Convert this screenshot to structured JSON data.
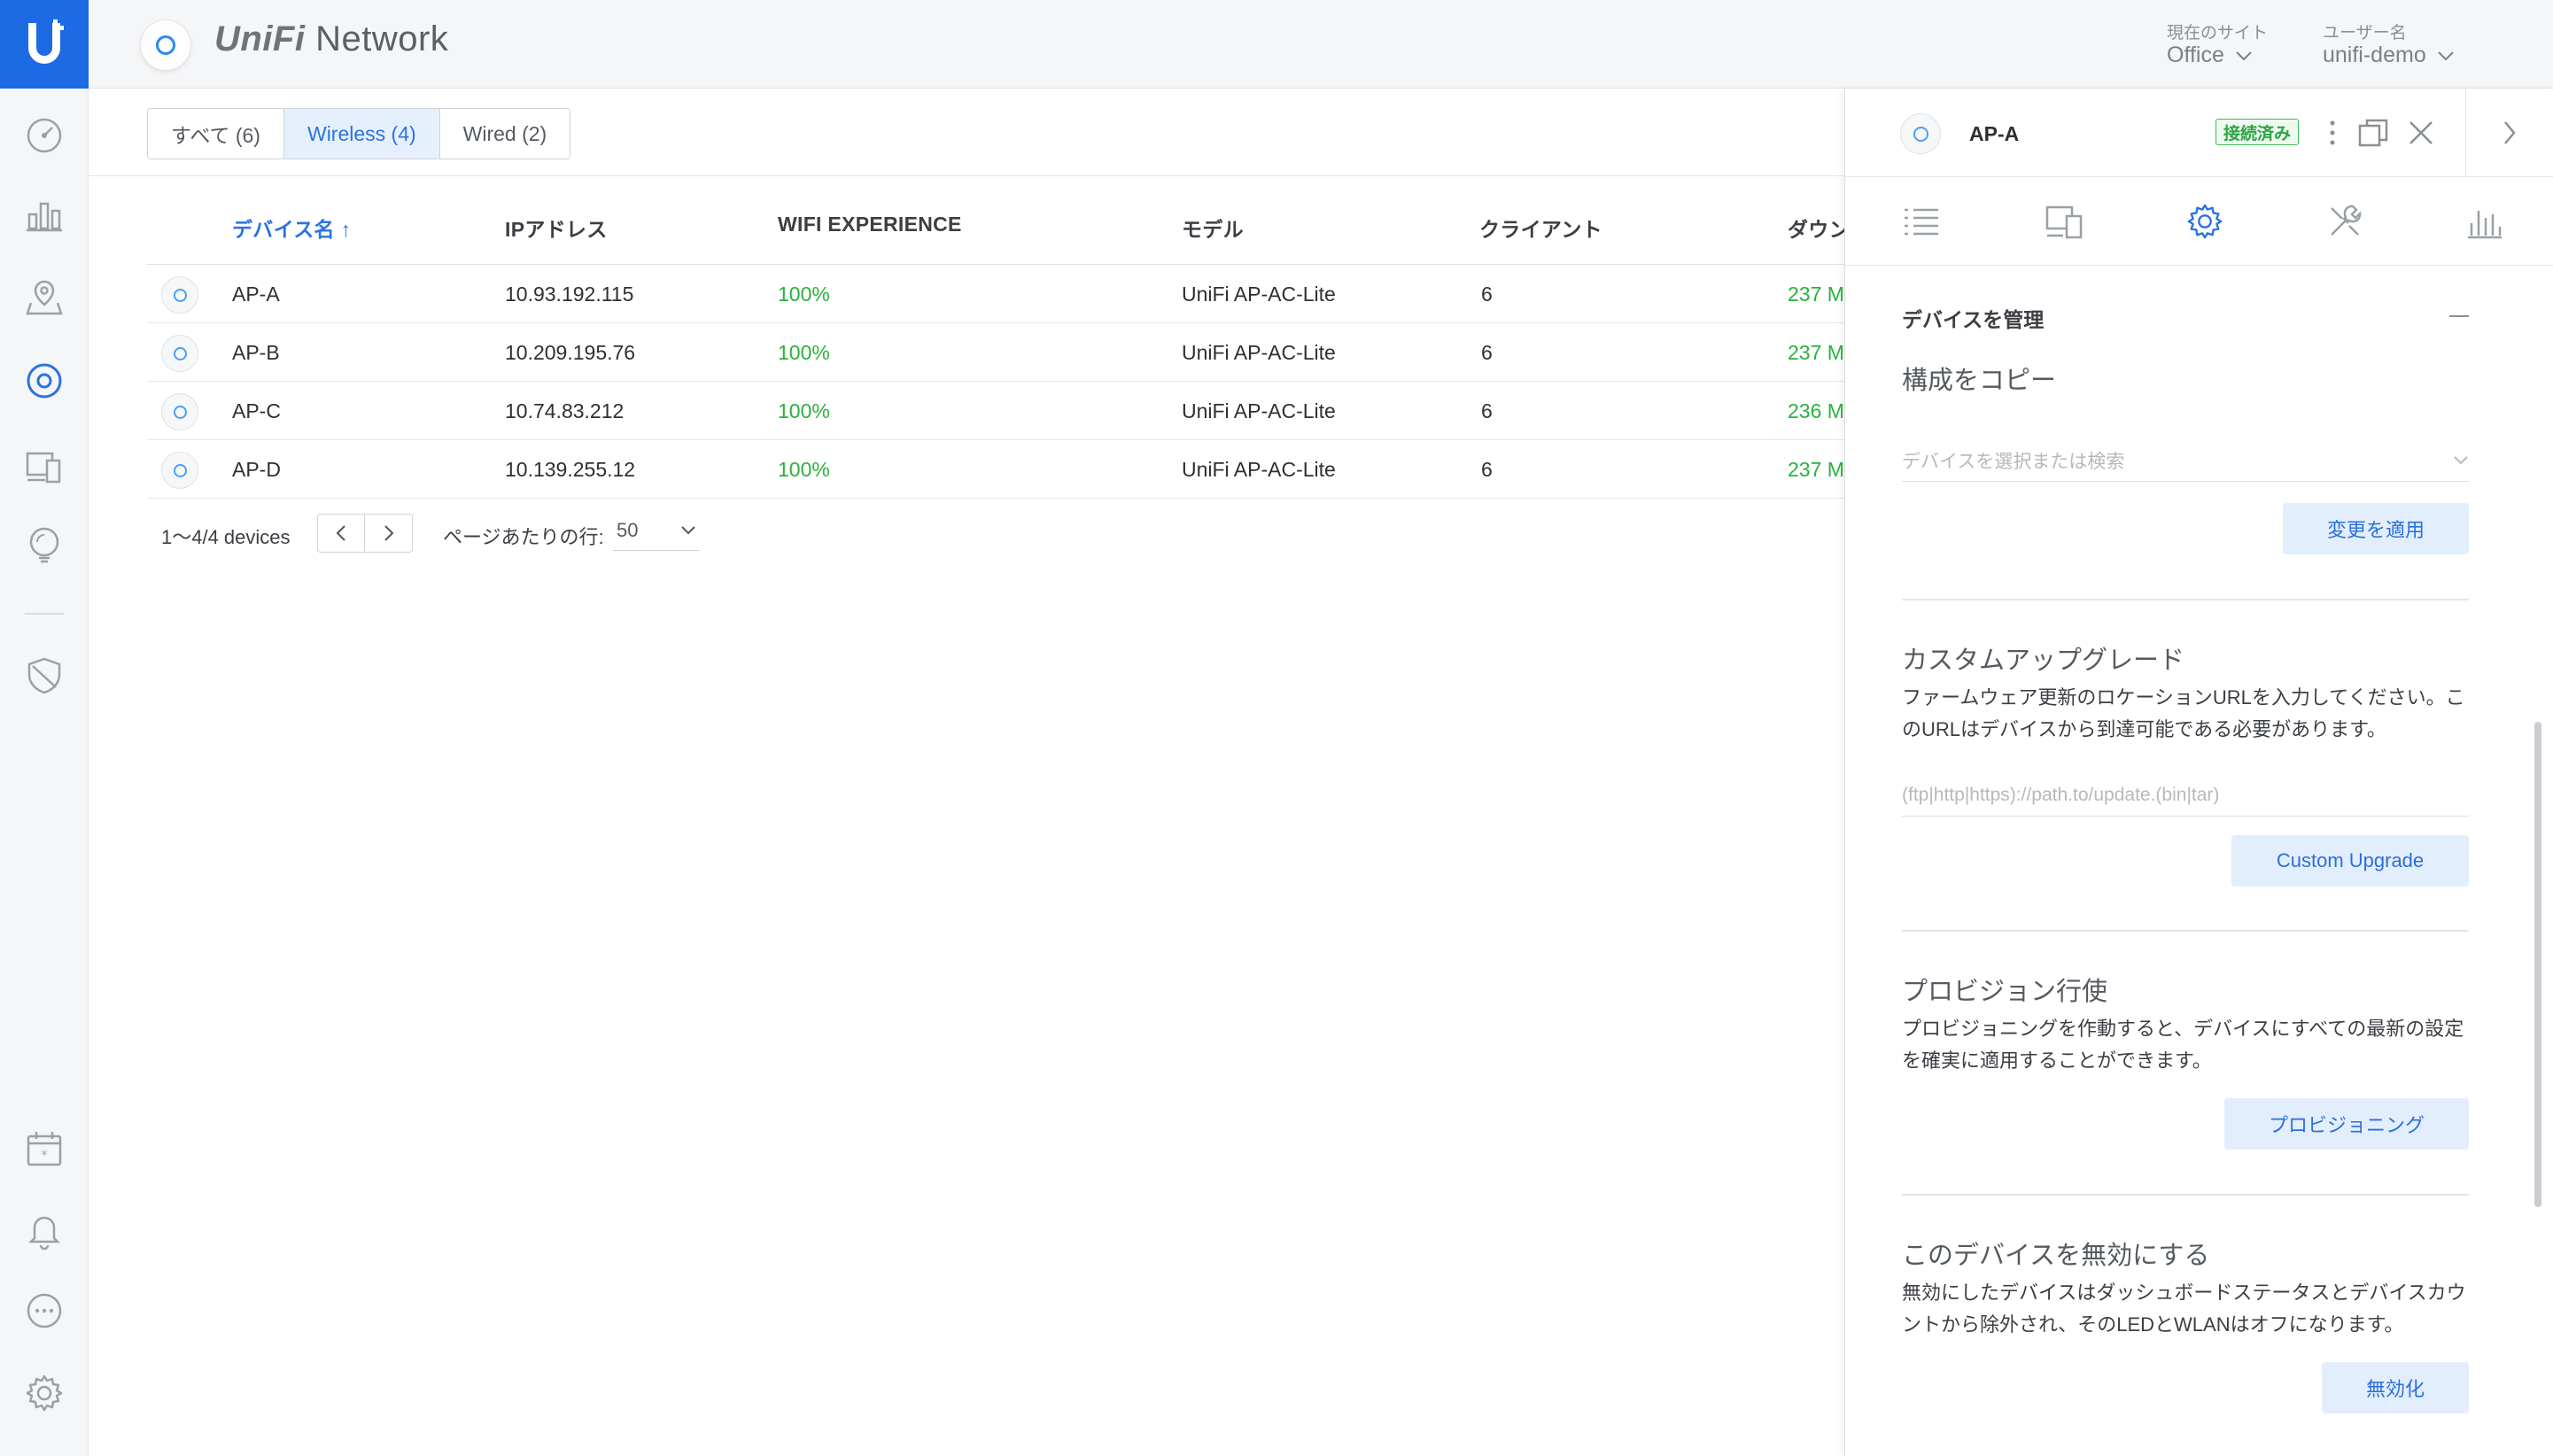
{
  "app": {
    "brand_prefix": "UniFi",
    "brand_suffix": " Network"
  },
  "header": {
    "site_label": "現在のサイト",
    "site_value": "Office",
    "user_label": "ユーザー名",
    "user_value": "unifi-demo"
  },
  "filters": [
    {
      "label": "すべて (6)"
    },
    {
      "label": "Wireless (4)"
    },
    {
      "label": "Wired (2)"
    }
  ],
  "table": {
    "columns": {
      "name": "デバイス名 ↑",
      "ip": "IPアドレス",
      "wifi": "WIFI EXPERIENCE",
      "model": "モデル",
      "clients": "クライアント",
      "download": "ダウン"
    },
    "rows": [
      {
        "name": "AP-A",
        "ip": "10.93.192.115",
        "wifi": "100%",
        "model": "UniFi AP-AC-Lite",
        "clients": "6",
        "download": "237 M"
      },
      {
        "name": "AP-B",
        "ip": "10.209.195.76",
        "wifi": "100%",
        "model": "UniFi AP-AC-Lite",
        "clients": "6",
        "download": "237 M"
      },
      {
        "name": "AP-C",
        "ip": "10.74.83.212",
        "wifi": "100%",
        "model": "UniFi AP-AC-Lite",
        "clients": "6",
        "download": "236 M"
      },
      {
        "name": "AP-D",
        "ip": "10.139.255.12",
        "wifi": "100%",
        "model": "UniFi AP-AC-Lite",
        "clients": "6",
        "download": "237 M"
      }
    ]
  },
  "pagination": {
    "range": "1〜4/4 devices",
    "rows_per_page_label": "ページあたりの行:",
    "rows_per_page": "50"
  },
  "panel": {
    "device_name": "AP-A",
    "status": "接続済み",
    "section_title": "デバイスを管理",
    "copy_config": {
      "title": "構成をコピー",
      "placeholder": "デバイスを選択または検索",
      "button": "変更を適用"
    },
    "custom_upgrade": {
      "title": "カスタムアップグレード",
      "desc_line1": "ファームウェア更新のロケーションURLを入力してください。こ",
      "desc_line2": "のURLはデバイスから到達可能である必要があります。",
      "placeholder": "(ftp|http|https)://path.to/update.(bin|tar)",
      "button": "Custom Upgrade"
    },
    "provision": {
      "title": "プロビジョン行使",
      "desc_line1": "プロビジョニングを作動すると、デバイスにすべての最新の設定",
      "desc_line2": "を確実に適用することができます。",
      "button": "プロビジョニング"
    },
    "disable": {
      "title": "このデバイスを無効にする",
      "desc_line1": "無効にしたデバイスはダッシュボードステータスとデバイスカウ",
      "desc_line2": "ントから除外され、そのLEDとWLANはオフになります。",
      "button": "無効化"
    }
  },
  "colors": {
    "accent": "#1d6ae5",
    "success": "#29b23d",
    "link": "#2a73e0"
  }
}
